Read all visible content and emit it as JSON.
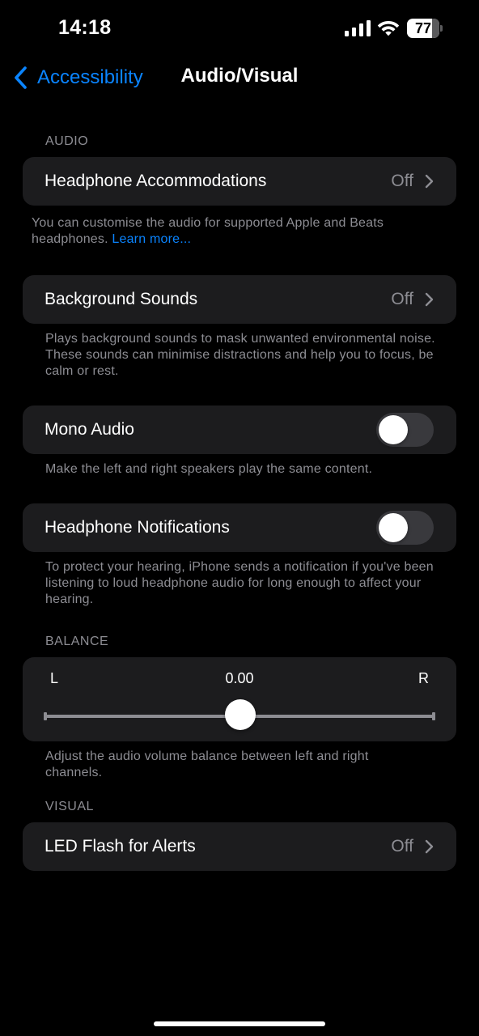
{
  "status_bar": {
    "time": "14:18",
    "battery_level": "77",
    "battery_fraction": 0.77
  },
  "nav": {
    "back_label": "Accessibility",
    "title": "Audio/Visual"
  },
  "audio_section": {
    "header": "AUDIO",
    "headphone_accommodations": {
      "label": "Headphone Accommodations",
      "value": "Off",
      "footer": "You can customise the audio for supported Apple and Beats headphones.",
      "footer_link": "Learn more..."
    },
    "background_sounds": {
      "label": "Background Sounds",
      "value": "Off",
      "footer": "Plays background sounds to mask unwanted environmental noise. These sounds can minimise distractions and help you to focus, be calm or rest."
    },
    "mono_audio": {
      "label": "Mono Audio",
      "enabled": false,
      "footer": "Make the left and right speakers play the same content."
    },
    "headphone_notifications": {
      "label": "Headphone Notifications",
      "enabled": false,
      "footer": "To protect your hearing, iPhone sends a notification if you've been listening to loud headphone audio for long enough to affect your hearing."
    }
  },
  "balance_section": {
    "header": "BALANCE",
    "left_label": "L",
    "right_label": "R",
    "value_text": "0.00",
    "value": 0.0,
    "footer": "Adjust the audio volume balance between left and right channels."
  },
  "visual_section": {
    "header": "VISUAL",
    "led_flash": {
      "label": "LED Flash for Alerts",
      "value": "Off"
    }
  },
  "colors": {
    "background": "#000000",
    "card": "#1c1c1e",
    "accent": "#0a84ff",
    "secondary_text": "#8d8d93",
    "toggle_off": "#39393d"
  }
}
